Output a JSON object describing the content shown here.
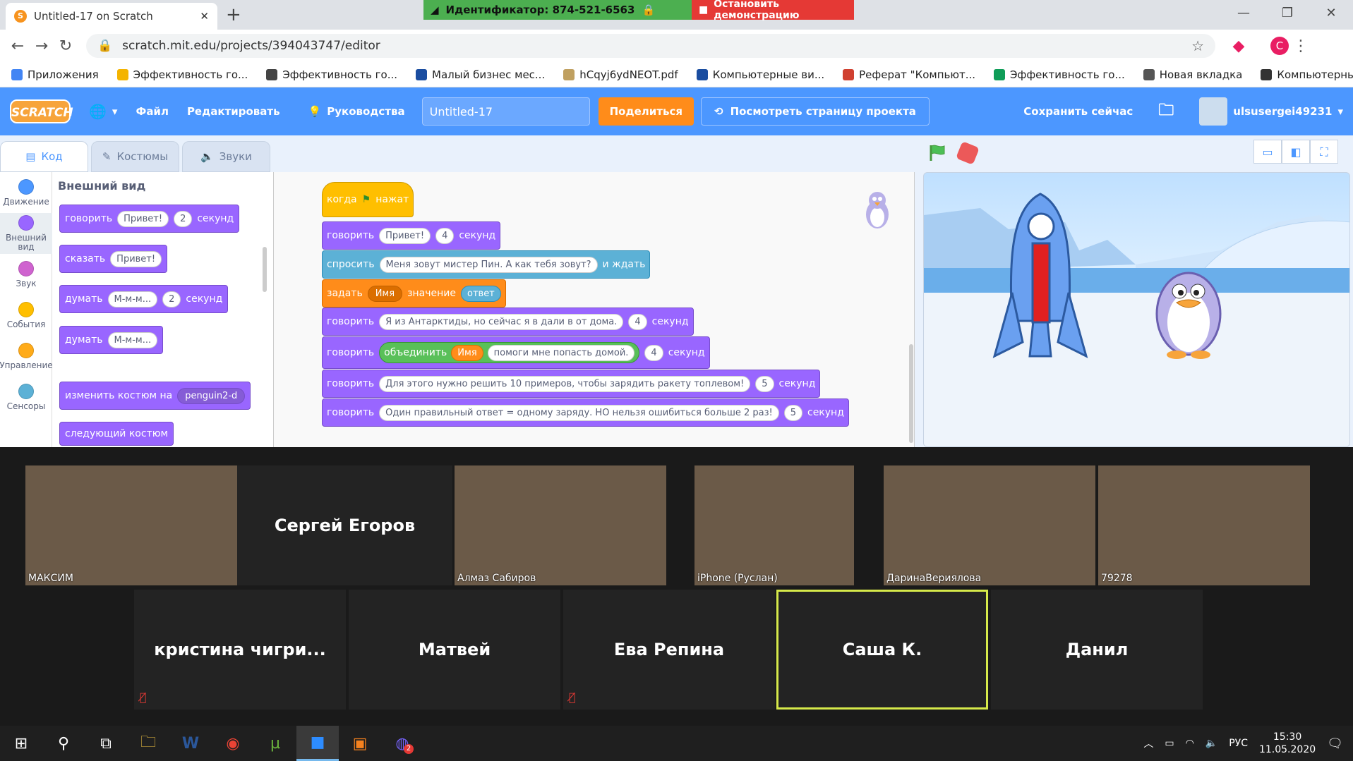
{
  "browser": {
    "tab_title": "Untitled-17 on Scratch",
    "url": "scratch.mit.edu/projects/394043747/editor",
    "profile_initial": "C"
  },
  "zoom_bar": {
    "id_text": "Идентификатор: 874-521-6563",
    "stop_text": "Остановить демонстрацию"
  },
  "bookmarks": [
    {
      "label": "Приложения",
      "color": "#4285f4"
    },
    {
      "label": "Эффективность го...",
      "color": "#f4b400"
    },
    {
      "label": "Эффективность го...",
      "color": "#444444"
    },
    {
      "label": "Малый бизнес мес...",
      "color": "#1a4da0"
    },
    {
      "label": "hCqyj6ydNEOT.pdf",
      "color": "#c0a060"
    },
    {
      "label": "Компьютерные ви...",
      "color": "#1a4da0"
    },
    {
      "label": "Реферат \"Компьют...",
      "color": "#d04030"
    },
    {
      "label": "Эффективность го...",
      "color": "#0f9d58"
    },
    {
      "label": "Новая вкладка",
      "color": "#555555"
    },
    {
      "label": "Компьютерные ви...",
      "color": "#333333"
    }
  ],
  "scratch_menu": {
    "logo": "SCRATCH",
    "file": "Файл",
    "edit": "Редактировать",
    "tutorials": "Руководства",
    "project_title": "Untitled-17",
    "share": "Поделиться",
    "see_project": "Посмотреть страницу проекта",
    "save_now": "Сохранить сейчас",
    "username": "ulsusergei49231"
  },
  "editor_tabs": [
    "Код",
    "Костюмы",
    "Звуки"
  ],
  "categories": [
    {
      "label": "Движение",
      "color": "#4c97ff"
    },
    {
      "label": "Внешний вид",
      "color": "#9966ff"
    },
    {
      "label": "Звук",
      "color": "#cf63cf"
    },
    {
      "label": "События",
      "color": "#ffbf00"
    },
    {
      "label": "Управление",
      "color": "#ffab19"
    },
    {
      "label": "Сенсоры",
      "color": "#5cb1d6"
    }
  ],
  "palette": {
    "heading": "Внешний вид",
    "say_secs": {
      "a": "говорить",
      "msg": "Привет!",
      "n": "2",
      "b": "секунд"
    },
    "say": {
      "a": "сказать",
      "msg": "Привет!"
    },
    "think_secs": {
      "a": "думать",
      "msg": "М-м-м...",
      "n": "2",
      "b": "секунд"
    },
    "think": {
      "a": "думать",
      "msg": "М-м-м..."
    },
    "switch_costume": {
      "a": "изменить костюм на",
      "costume": "penguin2-d"
    },
    "next_costume": "следующий костюм"
  },
  "script": {
    "hat": {
      "a": "когда",
      "b": "нажат"
    },
    "b1": {
      "a": "говорить",
      "msg": "Привет!",
      "n": "4",
      "b": "секунд"
    },
    "b2": {
      "a": "спросить",
      "msg": "Меня зовут мистер Пин. А как тебя зовут?",
      "b": "и ждать"
    },
    "b3": {
      "a": "задать",
      "var": "Имя",
      "b": "значение",
      "c": "ответ"
    },
    "b4": {
      "a": "говорить",
      "msg": "Я из Антарктиды, но сейчас я в дали в от дома.",
      "n": "4",
      "b": "секунд"
    },
    "b5": {
      "a": "говорить",
      "join": "объединить",
      "var": "Имя",
      "msg": "помоги мне попасть домой.",
      "n": "4",
      "b": "секунд"
    },
    "b6": {
      "a": "говорить",
      "msg": "Для этого нужно решить 10 примеров, чтобы зарядить ракету топлевом!",
      "n": "5",
      "b": "секунд"
    },
    "b7": {
      "a": "говорить",
      "msg": "Один правильный ответ = одному заряду. НО нельзя ошибиться  больше 2 раз!",
      "n": "5",
      "b": "секунд"
    }
  },
  "participants_row1": [
    {
      "name": "МАКСИМ",
      "video": true
    },
    {
      "name": "Сергей Егоров",
      "video": false
    },
    {
      "name": "Алмаз Сабиров",
      "video": true
    },
    {
      "name": "iPhone (Руслан)",
      "video": true
    },
    {
      "name": "ДаринаВериялова",
      "video": true
    },
    {
      "name": "79278",
      "video": true
    }
  ],
  "participants_row2": [
    {
      "name": "кристина  чигри...",
      "muted": true
    },
    {
      "name": "Матвей",
      "muted": false
    },
    {
      "name": "Ева Репина",
      "muted": true
    },
    {
      "name": "Саша К.",
      "muted": false,
      "active": true
    },
    {
      "name": "Данил",
      "muted": false
    }
  ],
  "taskbar": {
    "lang": "РУС",
    "time": "15:30",
    "date": "11.05.2020",
    "viber_badge": "2"
  }
}
